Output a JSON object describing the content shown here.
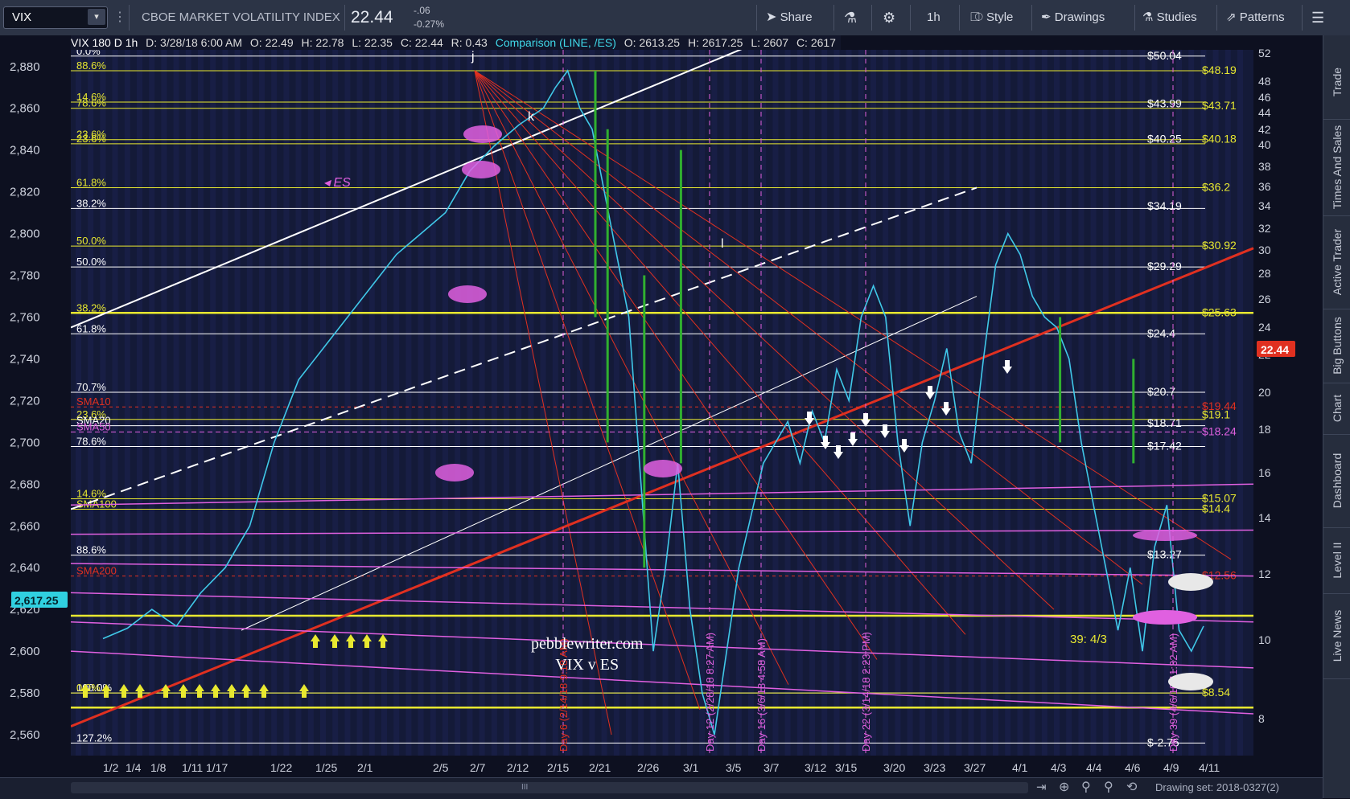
{
  "toolbar": {
    "symbol": "VIX",
    "symbol_dropdown_glyph": "▾",
    "instrument_name": "CBOE MARKET VOLATILITY INDEX",
    "last_price": "22.44",
    "change": "-.06",
    "change_pct": "-0.27%",
    "share_label": "Share",
    "timeframe_label": "1h",
    "style_label": "Style",
    "drawings_label": "Drawings",
    "studies_label": "Studies",
    "patterns_label": "Patterns"
  },
  "infobar": {
    "study_label": "VIX 180 D 1h",
    "date": "D: 3/28/18 6:00 AM",
    "open": "O: 22.49",
    "high": "H: 22.78",
    "low": "L: 22.35",
    "close": "C: 22.44",
    "range": "R: 0.43",
    "comparison": "Comparison (LINE, /ES)",
    "cmp_open": "O: 2613.25",
    "cmp_high": "H: 2617.25",
    "cmp_low": "L: 2607",
    "cmp_close": "C: 2617"
  },
  "sidebar": {
    "items": [
      "Trade",
      "Times And Sales",
      "Active Trader",
      "Big Buttons",
      "Chart",
      "Dashboard",
      "Level II",
      "Live News"
    ]
  },
  "bottombar": {
    "drawing_set": "Drawing set: 2018-0327(2)",
    "scroll_glyph": "III"
  },
  "watermark": {
    "line1": "pebblewriter.com",
    "line2": "VIX v ES"
  },
  "colors": {
    "background": "#0d1020",
    "fib_white": "#ffffff",
    "fib_yellow": "#e8e830",
    "trend_red": "#e03020",
    "magenta": "#e060e0",
    "es_line": "#40c8e8",
    "vix_candles": "#30b030",
    "price_tag": "#e03020",
    "es_tag": "#30d0e0"
  },
  "chart_data": {
    "type": "line",
    "title": "CBOE MARKET VOLATILITY INDEX",
    "left_axis": {
      "label": "/ES",
      "ticks": [
        "2,880",
        "2,860",
        "2,840",
        "2,820",
        "2,800",
        "2,780",
        "2,760",
        "2,740",
        "2,720",
        "2,700",
        "2,680",
        "2,660",
        "2,640",
        "2,620",
        "2,600",
        "2,580",
        "2,560"
      ],
      "ylim": [
        2550,
        2888
      ]
    },
    "right_axis": {
      "label": "VIX",
      "ticks": [
        "52",
        "48",
        "46",
        "44",
        "42",
        "40",
        "38",
        "36",
        "34",
        "32",
        "30",
        "28",
        "26",
        "24",
        "22",
        "20",
        "18",
        "16",
        "14",
        "12",
        "10",
        "8"
      ]
    },
    "x_ticks": [
      "1/2",
      "1/4",
      "1/8",
      "1/11",
      "1/17",
      "1/22",
      "1/25",
      "2/1",
      "2/5",
      "2/7",
      "2/12",
      "2/15",
      "2/21",
      "2/26",
      "3/1",
      "3/5",
      "3/7",
      "3/12",
      "3/15",
      "3/20",
      "3/23",
      "3/27",
      "4/1",
      "4/3",
      "4/4",
      "4/6",
      "4/9",
      "4/11"
    ],
    "last_vix_tag": "22.44",
    "last_es_tag": "2,617.25",
    "fib_left_labels": [
      {
        "text": "0.0%",
        "value": 2885,
        "color": "white"
      },
      {
        "text": "88.6%",
        "value": 2878,
        "color": "yellow"
      },
      {
        "text": "14.6%",
        "value": 2863,
        "color": "yellow"
      },
      {
        "text": "78.6%",
        "value": 2860,
        "color": "yellow"
      },
      {
        "text": "23.6%",
        "value": 2845,
        "color": "yellow"
      },
      {
        "text": "23.6%",
        "value": 2843,
        "color": "yellow"
      },
      {
        "text": "61.8%",
        "value": 2822,
        "color": "yellow"
      },
      {
        "text": "38.2%",
        "value": 2812,
        "color": "white"
      },
      {
        "text": "50.0%",
        "value": 2794,
        "color": "yellow"
      },
      {
        "text": "50.0%",
        "value": 2784,
        "color": "white"
      },
      {
        "text": "38.2%",
        "value": 2762,
        "color": "yellow"
      },
      {
        "text": "61.8%",
        "value": 2752,
        "color": "white"
      },
      {
        "text": "70.7%",
        "value": 2724,
        "color": "white"
      },
      {
        "text": "SMA10",
        "value": 2717,
        "color": "red"
      },
      {
        "text": "23.6%",
        "value": 2711,
        "color": "yellow"
      },
      {
        "text": "SMA20",
        "value": 2708,
        "color": "white"
      },
      {
        "text": "SMA50",
        "value": 2705,
        "color": "magenta"
      },
      {
        "text": "78.6%",
        "value": 2698,
        "color": "white"
      },
      {
        "text": "14.6%",
        "value": 2673,
        "color": "yellow"
      },
      {
        "text": "SMA100",
        "value": 2668,
        "color": "yellow"
      },
      {
        "text": "88.6%",
        "value": 2646,
        "color": "white"
      },
      {
        "text": "SMA200",
        "value": 2636,
        "color": "red"
      },
      {
        "text": "100.0%",
        "value": 2580,
        "color": "white"
      },
      {
        "text": "0.0%",
        "value": 2580,
        "color": "yellow"
      },
      {
        "text": "127.2%",
        "value": 2556,
        "color": "white"
      }
    ],
    "fib_right_labels": [
      {
        "text": "$50.04",
        "value": 2885,
        "color": "white"
      },
      {
        "text": "$48.19",
        "value": 2878,
        "color": "yellow"
      },
      {
        "text": "$43.99",
        "value": 2862,
        "color": "white"
      },
      {
        "text": "$43.71",
        "value": 2861,
        "color": "yellow"
      },
      {
        "text": "$40.25",
        "value": 2845,
        "color": "white"
      },
      {
        "text": "$40.18",
        "value": 2845,
        "color": "yellow"
      },
      {
        "text": "$36.2",
        "value": 2822,
        "color": "yellow"
      },
      {
        "text": "$34.19",
        "value": 2813,
        "color": "white"
      },
      {
        "text": "$30.92",
        "value": 2794,
        "color": "yellow"
      },
      {
        "text": "$29.29",
        "value": 2784,
        "color": "white"
      },
      {
        "text": "$25.63",
        "value": 2762,
        "color": "yellow"
      },
      {
        "text": "$24.4",
        "value": 2752,
        "color": "white"
      },
      {
        "text": "$20.7",
        "value": 2724,
        "color": "white"
      },
      {
        "text": "$19.44",
        "value": 2717,
        "color": "red"
      },
      {
        "text": "$19.1",
        "value": 2713,
        "color": "yellow"
      },
      {
        "text": "$18.71",
        "value": 2709,
        "color": "white"
      },
      {
        "text": "$18.24",
        "value": 2705,
        "color": "magenta"
      },
      {
        "text": "$17.42",
        "value": 2698,
        "color": "white"
      },
      {
        "text": "$15.07",
        "value": 2673,
        "color": "yellow"
      },
      {
        "text": "$14.4",
        "value": 2668,
        "color": "yellow"
      },
      {
        "text": "$13.27",
        "value": 2646,
        "color": "white"
      },
      {
        "text": "$12.56",
        "value": 2636,
        "color": "red"
      },
      {
        "text": "$8.54",
        "value": 2580,
        "color": "yellow"
      },
      {
        "text": "$-2.75",
        "value": 2556,
        "color": "white"
      }
    ],
    "wave_labels": [
      "j",
      "k",
      "l"
    ],
    "es_marker": "ES",
    "vertical_annotations": [
      "Day 6 (2/14/18 9:18 AM)",
      "Day 12 (2/28/18 8:27 AM)",
      "Day 16 (3/6/18 4:58 AM)",
      "Day 22 (3/14/18 2:23 PM)",
      "Day 39 (4/6/18 11:32 AM)"
    ],
    "cycle_label": "39:  4/3",
    "es_series": [
      [
        0,
        2606
      ],
      [
        2,
        2611
      ],
      [
        4,
        2620
      ],
      [
        6,
        2612
      ],
      [
        8,
        2628
      ],
      [
        10,
        2640
      ],
      [
        12,
        2660
      ],
      [
        14,
        2700
      ],
      [
        16,
        2730
      ],
      [
        18,
        2745
      ],
      [
        20,
        2760
      ],
      [
        22,
        2775
      ],
      [
        24,
        2790
      ],
      [
        26,
        2800
      ],
      [
        28,
        2810
      ],
      [
        30,
        2830
      ],
      [
        32,
        2842
      ],
      [
        34,
        2852
      ],
      [
        36,
        2860
      ],
      [
        37,
        2870
      ],
      [
        38,
        2878
      ],
      [
        39,
        2860
      ],
      [
        40,
        2850
      ],
      [
        41,
        2820
      ],
      [
        42,
        2790
      ],
      [
        43,
        2760
      ],
      [
        44,
        2680
      ],
      [
        45,
        2600
      ],
      [
        46,
        2640
      ],
      [
        47,
        2690
      ],
      [
        48,
        2620
      ],
      [
        49,
        2580
      ],
      [
        50,
        2560
      ],
      [
        51,
        2600
      ],
      [
        52,
        2640
      ],
      [
        53,
        2665
      ],
      [
        54,
        2690
      ],
      [
        55,
        2700
      ],
      [
        56,
        2710
      ],
      [
        57,
        2690
      ],
      [
        58,
        2715
      ],
      [
        59,
        2700
      ],
      [
        60,
        2735
      ],
      [
        61,
        2720
      ],
      [
        62,
        2760
      ],
      [
        63,
        2775
      ],
      [
        64,
        2760
      ],
      [
        65,
        2700
      ],
      [
        66,
        2660
      ],
      [
        67,
        2700
      ],
      [
        68,
        2720
      ],
      [
        69,
        2745
      ],
      [
        70,
        2705
      ],
      [
        71,
        2690
      ],
      [
        72,
        2740
      ],
      [
        73,
        2785
      ],
      [
        74,
        2800
      ],
      [
        75,
        2790
      ],
      [
        76,
        2770
      ],
      [
        77,
        2760
      ],
      [
        78,
        2755
      ],
      [
        79,
        2740
      ],
      [
        80,
        2700
      ],
      [
        81,
        2670
      ],
      [
        82,
        2640
      ],
      [
        83,
        2610
      ],
      [
        84,
        2640
      ],
      [
        85,
        2600
      ],
      [
        86,
        2650
      ],
      [
        87,
        2670
      ],
      [
        88,
        2610
      ],
      [
        89,
        2600
      ],
      [
        90,
        2612
      ]
    ]
  }
}
